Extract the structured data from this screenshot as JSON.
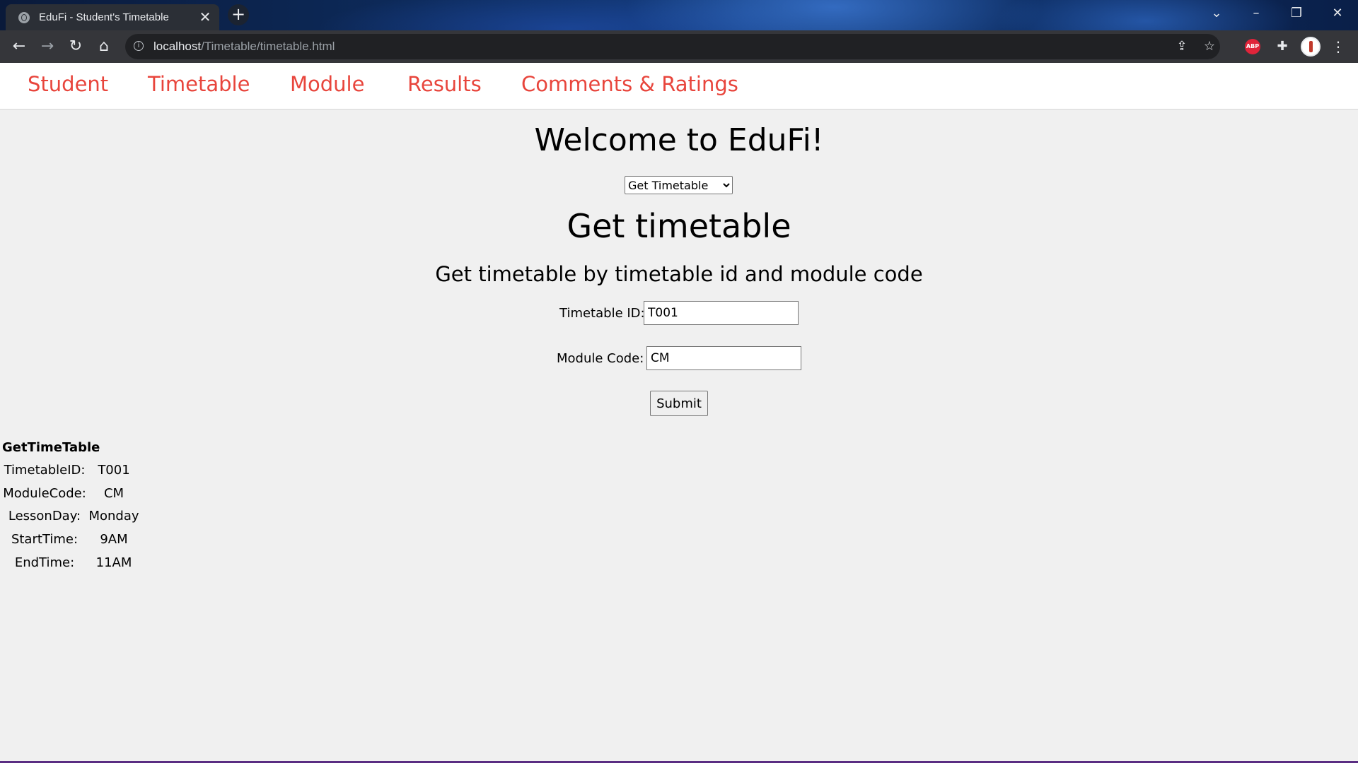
{
  "browser": {
    "tab_title": "EduFi - Student's Timetable",
    "tab_close": "✕",
    "new_tab": "+",
    "url_host": "localhost",
    "url_path": "/Timetable/timetable.html",
    "abp_label": "ABP"
  },
  "nav": {
    "items": [
      "Student",
      "Timetable",
      "Module",
      "Results",
      "Comments & Ratings"
    ]
  },
  "page": {
    "welcome": "Welcome to EduFi!",
    "select_value": "Get Timetable",
    "heading": "Get timetable",
    "subheading": "Get timetable by timetable id and module code",
    "timetable_id_label": "Timetable ID:",
    "timetable_id_value": "T001",
    "module_code_label": "Module Code:",
    "module_code_value": "CM",
    "submit_label": "Submit"
  },
  "result": {
    "title": "GetTimeTable",
    "rows": [
      {
        "key": "TimetableID:",
        "value": "T001"
      },
      {
        "key": "ModuleCode:",
        "value": "CM"
      },
      {
        "key": "LessonDay:",
        "value": "Monday"
      },
      {
        "key": "StartTime:",
        "value": "9AM"
      },
      {
        "key": "EndTime:",
        "value": "11AM"
      }
    ]
  },
  "colors": {
    "nav_link": "#e8453c",
    "toolbar": "#35363a",
    "page_bg": "#f0f0f0"
  }
}
